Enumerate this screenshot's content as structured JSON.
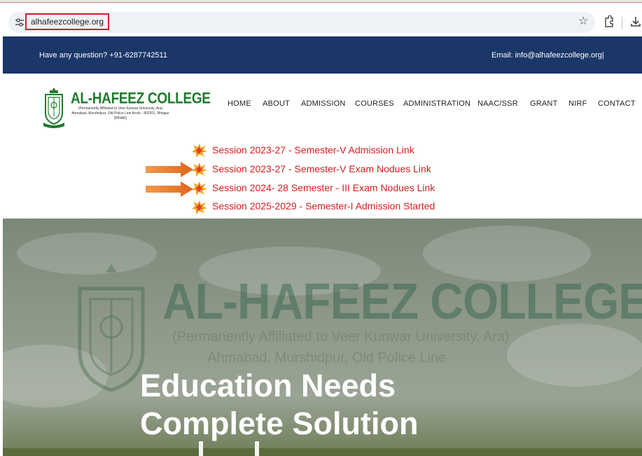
{
  "browser": {
    "url": "alhafeezcollege.org",
    "icons": [
      "tune-icon",
      "star-icon",
      "extensions-icon",
      "download-icon"
    ]
  },
  "infobar": {
    "question": "Have any question? +91-6287742511",
    "email": "Email: info@alhafeezcollege.org|"
  },
  "brand": {
    "name": "AL-HAFEEZ COLLEGE",
    "address": "(Permanently Affiliated to Veer Kunwar University, Ara) Ahmabad, Murshidpur, Old Police Line Arrah - 802301, Bhojpur (BIHAR)"
  },
  "nav": {
    "items": [
      "HOME",
      "ABOUT",
      "ADMISSION",
      "COURSES",
      "ADMINISTRATION",
      "NAAC/SSR",
      "GRANT",
      "NIRF",
      "CONTACT"
    ]
  },
  "notices": [
    "Session 2023-27 - Semester-V Admission Link",
    "Session 2023-27 - Semester-V Exam Nodues Link",
    "Session 2024- 28 Semester - III Exam Nodues Link",
    "Session 2025-2029 - Semester-I Admission Started"
  ],
  "hero": {
    "watermark_title": "AL-HAFEEZ COLLEGE",
    "watermark_line1": "(Permanently Affiliated to Veer Kunwar University, Ara)",
    "watermark_line2": "Ahmabad, Murshidpur, Old Police Line",
    "title_line1": "Education Needs",
    "title_line2": "Complete Solution"
  },
  "colors": {
    "infobar_bg": "#1a3768",
    "brand_green": "#1e7b2e",
    "notice_red": "#d21f1f",
    "arrow_orange": "#ef7a22",
    "url_highlight": "#d0202a"
  }
}
